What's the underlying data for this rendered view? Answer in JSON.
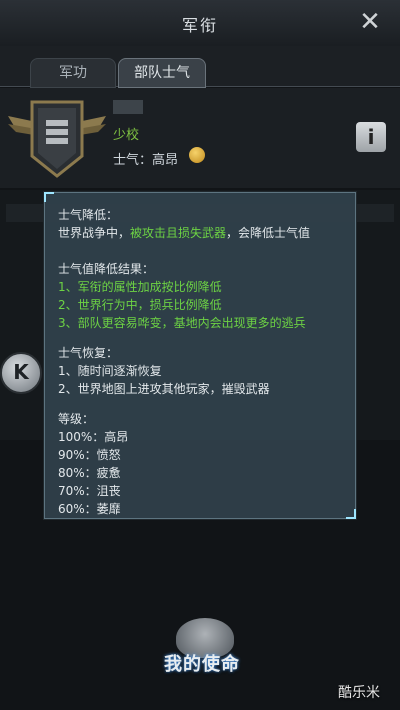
{
  "header": {
    "title": "军衔",
    "close_icon": "close-icon"
  },
  "tabs": [
    {
      "label": "军功",
      "active": false
    },
    {
      "label": "部队士气",
      "active": true
    }
  ],
  "profile": {
    "rank": "少校",
    "morale_label": "士气：高昂",
    "morale_icon": "smiley-icon",
    "badge_icon": "rank-badge-icon",
    "info_button": "i"
  },
  "side_nav": {
    "icon": "k-logo-icon",
    "glyph": "K"
  },
  "popup": {
    "lines": [
      {
        "text": "士气降低：",
        "color": "white"
      },
      {
        "text": "世界战争中，",
        "color": "white"
      },
      {
        "text": "被攻击且损失武器",
        "color": "green"
      },
      {
        "text": "，会降低士气值",
        "color": "white"
      },
      {
        "text": "士气值降低结果：",
        "color": "white"
      },
      {
        "text": "1、军衔的属性加成按比例降低",
        "color": "green"
      },
      {
        "text": "2、世界行为中，损兵比例降低",
        "color": "green"
      },
      {
        "text": "3、部队更容易哗变，基地内会出现更多的逃兵",
        "color": "green"
      },
      {
        "text": "士气恢复：",
        "color": "white"
      },
      {
        "text": "1、随时间逐渐恢复",
        "color": "white"
      },
      {
        "text": "2、世界地图上进攻其他玩家，摧毁武器",
        "color": "white"
      },
      {
        "text": "等级：",
        "color": "white"
      },
      {
        "text": "100%：高昂",
        "color": "white"
      },
      {
        "text": "90%：愤怒",
        "color": "white"
      },
      {
        "text": "80%：疲惫",
        "color": "white"
      },
      {
        "text": "70%：沮丧",
        "color": "white"
      },
      {
        "text": "60%：萎靡",
        "color": "white"
      }
    ]
  },
  "logo_text": "我的使命",
  "watermark": "酷乐米",
  "colors": {
    "accent_green": "#6dd344",
    "popup_bg": "#30404a"
  }
}
